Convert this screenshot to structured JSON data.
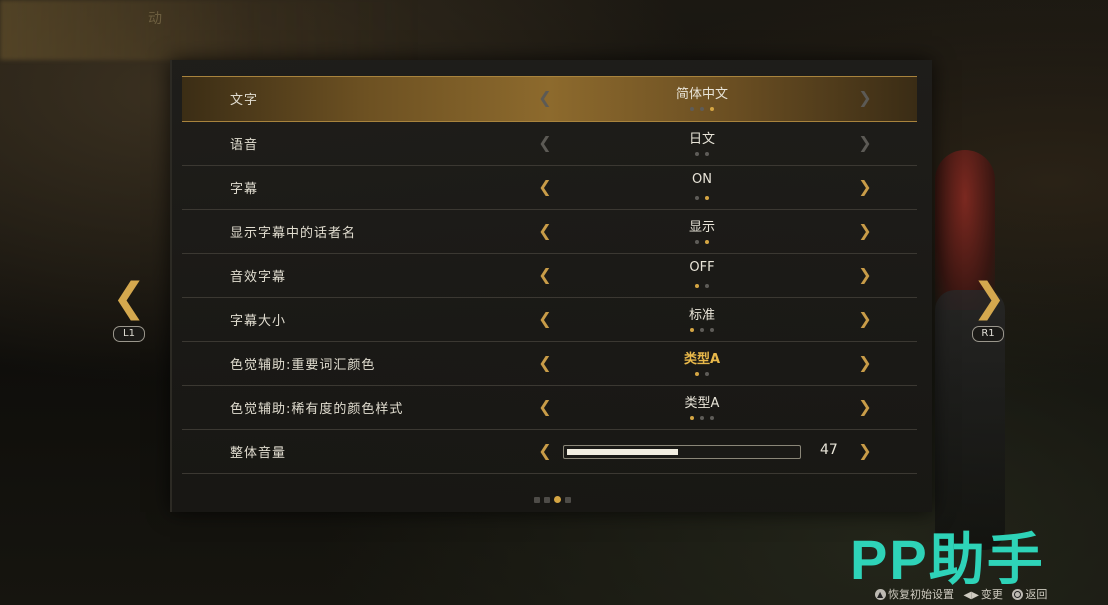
{
  "header": {
    "title": "动"
  },
  "settings": [
    {
      "label": "文字",
      "value": "简体中文",
      "dots": [
        false,
        false,
        true
      ],
      "selected": true,
      "dim": true
    },
    {
      "label": "语音",
      "value": "日文",
      "dots": [
        false,
        false
      ],
      "selected": false,
      "dim": true
    },
    {
      "label": "字幕",
      "value": "ON",
      "dots": [
        false,
        true
      ],
      "selected": false,
      "dim": false
    },
    {
      "label": "显示字幕中的话者名",
      "value": "显示",
      "dots": [
        false,
        true
      ],
      "selected": false,
      "dim": false
    },
    {
      "label": "音效字幕",
      "value": "OFF",
      "dots": [
        true,
        false
      ],
      "selected": false,
      "dim": false
    },
    {
      "label": "字幕大小",
      "value": "标准",
      "dots": [
        true,
        false,
        false
      ],
      "selected": false,
      "dim": false
    },
    {
      "label": "色觉辅助:重要词汇颜色",
      "value": "类型A",
      "dots": [
        true,
        false
      ],
      "selected": false,
      "dim": false,
      "gold": true
    },
    {
      "label": "色觉辅助:稀有度的颜色样式",
      "value": "类型A",
      "dots": [
        true,
        false,
        false
      ],
      "selected": false,
      "dim": false
    },
    {
      "label": "整体音量",
      "slider": 0.47,
      "value": "47"
    }
  ],
  "pagination": {
    "pages": 4,
    "current": 3
  },
  "nav": {
    "left_badge": "L1",
    "right_badge": "R1"
  },
  "watermark": "PP助手",
  "footer": {
    "restore_label": "恢复初始设置",
    "change_label": "变更",
    "back_label": "返回"
  },
  "colors": {
    "accent": "#d4a543",
    "watermark": "#2ed3b8"
  }
}
